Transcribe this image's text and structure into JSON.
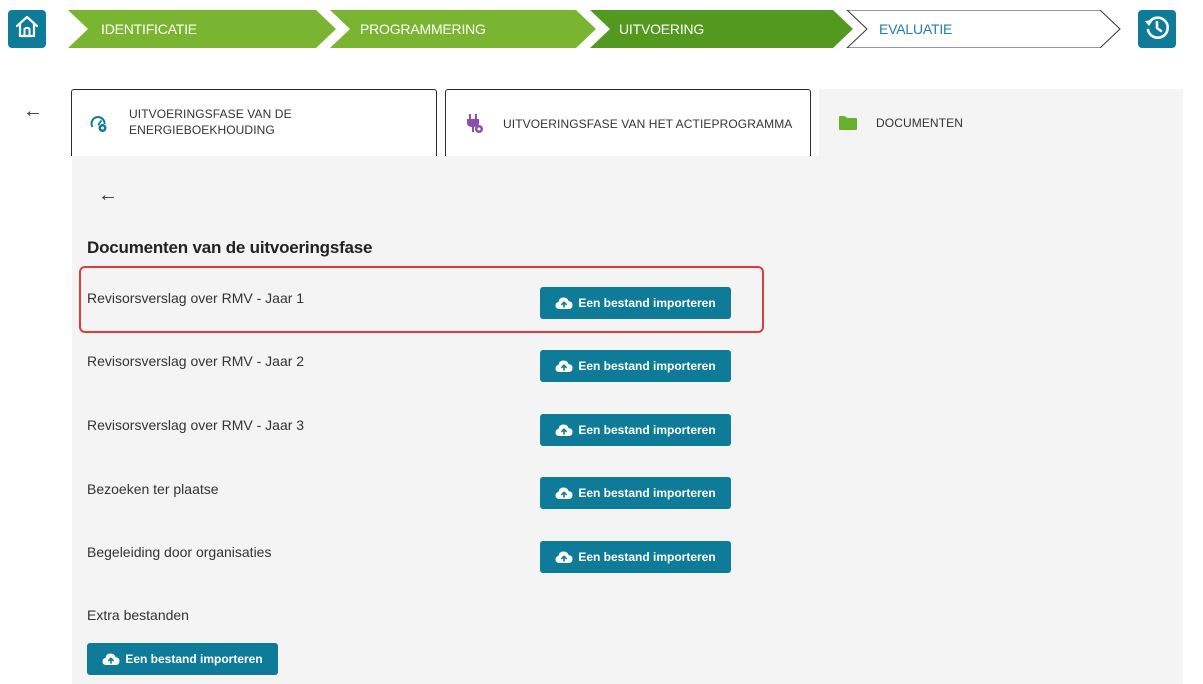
{
  "nav": {
    "home_icon": "home-icon",
    "history_icon": "history-icon",
    "steps": [
      {
        "label": "IDENTIFICATIE",
        "state": "done"
      },
      {
        "label": "PROGRAMMERING",
        "state": "done"
      },
      {
        "label": "UITVOERING",
        "state": "active"
      },
      {
        "label": "EVALUATIE",
        "state": "todo"
      }
    ],
    "colors": {
      "done": "#79b530",
      "active": "#53981f",
      "todo_text": "#1f7fb0",
      "accent": "#0e7c98"
    }
  },
  "tabs": [
    {
      "label": "UITVOERINGSFASE VAN DE ENERGIEBOEKHOUDING",
      "icon": "gauge-gear-icon"
    },
    {
      "label": "UITVOERINGSFASE VAN HET ACTIEPROGRAMMA",
      "icon": "plug-gear-icon"
    },
    {
      "label": "DOCUMENTEN",
      "icon": "folder-icon",
      "active": true
    }
  ],
  "section": {
    "title": "Documenten van de uitvoeringsfase",
    "documents": [
      {
        "label": "Revisorsverslag over RMV - Jaar 1",
        "button": "Een bestand importeren",
        "highlighted": true
      },
      {
        "label": "Revisorsverslag over RMV - Jaar 2",
        "button": "Een bestand importeren"
      },
      {
        "label": "Revisorsverslag over RMV - Jaar 3",
        "button": "Een bestand importeren"
      },
      {
        "label": "Bezoeken ter plaatse",
        "button": "Een bestand importeren"
      },
      {
        "label": "Begeleiding door organisaties",
        "button": "Een bestand importeren"
      }
    ],
    "extra": {
      "label": "Extra bestanden",
      "button": "Een bestand importeren"
    }
  }
}
